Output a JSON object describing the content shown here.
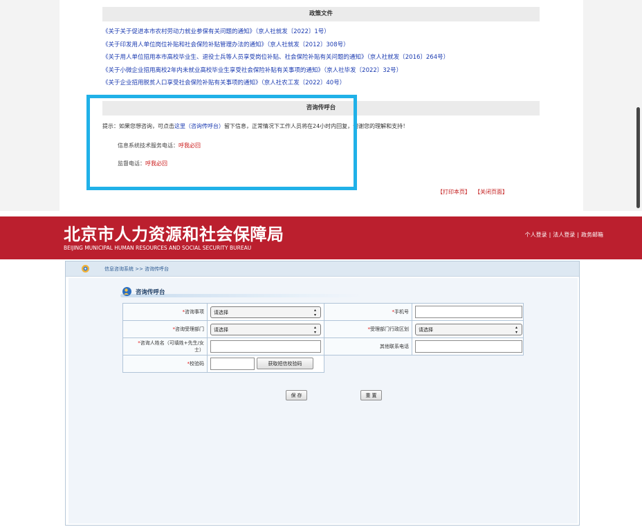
{
  "policy": {
    "section_title": "政策文件",
    "items": [
      "《关于关于促进本市农村劳动力就业参保有关问题的通知》（京人社就发〔2022〕1号）",
      "《关于印发用人单位岗位补贴和社会保险补贴管理办法的通知》（京人社就发〔2012〕308号）",
      "《关于用人单位招用本市高校毕业生、退役士兵等人员享受岗位补贴、社会保险补贴有关问题的通知》（京人社就发〔2016〕264号）",
      "《关于小微企业招用离校2年内未就业高校毕业生享受社会保险补贴有关事项的通知》（京人社毕发〔2022〕32号）",
      "《关于企业招用脱贫人口享受社会保险补贴有关事项的通知》（京人社农工发〔2022〕40号）"
    ]
  },
  "consult": {
    "section_title": "咨询传呼台",
    "notice_prefix": "提示：如果您想咨询，可点击",
    "notice_link": "这里（咨询传呼台）",
    "notice_suffix": "留下信息，正常情况下工作人员将在24小时内回复，谢谢您的理解和支持！",
    "tech_phone_label": "信息系统技术服务电话：",
    "tech_phone_value": "呼我必回",
    "supervise_phone_label": "监督电话：",
    "supervise_phone_value": "呼我必回"
  },
  "page_actions": {
    "print": "【打印本页】",
    "close": "【关闭页面】"
  },
  "header": {
    "title": "北京市人力资源和社会保障局",
    "subtitle": "BEIJING MUNICIPAL HUMAN RESOURCES AND SOCIAL SECURITY BUREAU",
    "links": [
      "个人登录",
      "法人登录",
      "政务邮箱"
    ],
    "separator": "|"
  },
  "form": {
    "breadcrumb": "信息咨询系统 >> 咨询传呼台",
    "title": "咨询传呼台",
    "required_mark": "*",
    "consult_item_label": "咨询事项",
    "consult_item_value": "请选择",
    "phone_label": "手机号",
    "dept_label": "咨询受理部门",
    "dept_value": "请选择",
    "district_label": "受理部门行政区划",
    "district_value": "请选择",
    "name_label_line1": "咨询人姓名（可填姓+先生/女",
    "name_label_line2": "士）",
    "other_phone_label": "其他联系电话",
    "captcha_label": "校验码",
    "sms_button": "获取短信校验码",
    "save_button": "保 存",
    "reset_button": "重 置"
  },
  "colors": {
    "header_red": "#bb1f2e",
    "link_blue": "#1a3ab0",
    "alert_red": "#cc1e1e",
    "highlight_blue": "#20b1e8"
  }
}
